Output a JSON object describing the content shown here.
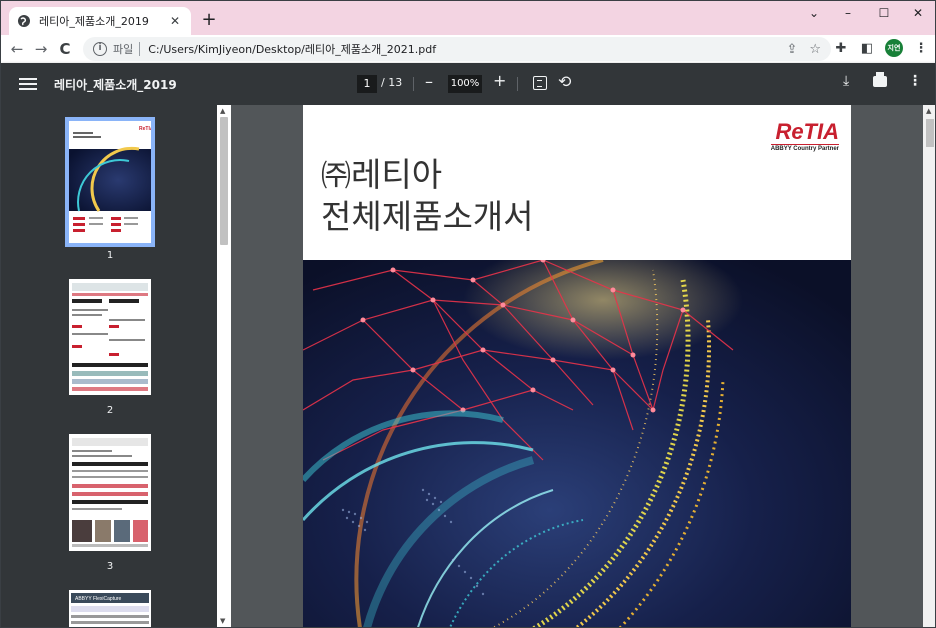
{
  "browser": {
    "tab_title": "레티아_제품소개_2019",
    "tab_close": "✕",
    "new_tab": "+",
    "window_controls": [
      "⌄",
      "–",
      "☐",
      "✕"
    ],
    "nav": {
      "back": "←",
      "forward": "→",
      "reload": "C"
    },
    "omnibox": {
      "info_glyph": "i",
      "scheme_label": "파일",
      "url": "C:/Users/KimJiyeon/Desktop/레티아_제품소개_2021.pdf",
      "share_glyph": "⇪",
      "star_glyph": "☆"
    },
    "profile_label": "지연",
    "extensions_glyph": "✚",
    "sidepanel_glyph": "◧",
    "menu_glyph": "⋮"
  },
  "viewer": {
    "title": "레티아_제품소개_2019",
    "page_current": "1",
    "page_total": "/ 13",
    "zoom": "100%",
    "zoom_out": "–",
    "zoom_in": "+",
    "rotate_glyph": "⟲",
    "download_glyph": "⤓",
    "more_glyph": "⋮"
  },
  "thumbnails": [
    {
      "label": "1",
      "selected": true
    },
    {
      "label": "2",
      "selected": false
    },
    {
      "label": "3",
      "selected": false
    }
  ],
  "thumb_page4_caption": "ABBYY FlexiCapture",
  "page": {
    "logo": "ReTIA",
    "partner": "ABBYY Country Partner",
    "title_line1_prefix": "㈜",
    "title_line1": "레티아",
    "title_line2": "전체제품소개서"
  },
  "colors": {
    "tab_strip": "#f3d4e2",
    "pdf_toolbar": "#323639",
    "viewer_bg": "#525659",
    "brand_red": "#c8202f",
    "selected_thumb": "#8ab4f8"
  }
}
